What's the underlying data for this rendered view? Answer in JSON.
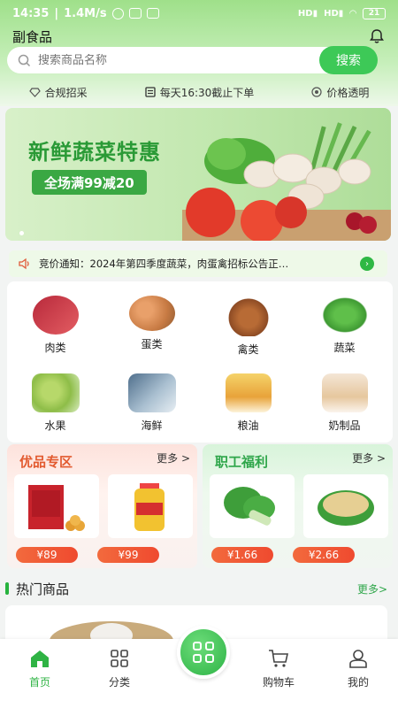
{
  "status": {
    "time": "14:35",
    "speed": "1.4M/s",
    "battery": "21"
  },
  "header": {
    "title": "副食品"
  },
  "search": {
    "placeholder": "搜索商品名称",
    "button": "搜索"
  },
  "features": [
    "合规招采",
    "每天16:30截止下单",
    "价格透明"
  ],
  "banner": {
    "title": "新鲜蔬菜特惠",
    "tag": "全场满99减20"
  },
  "notice": {
    "text": "竞价通知：2024年第四季度蔬菜，肉蛋禽招标公告正…"
  },
  "categories": [
    {
      "label": "肉类",
      "icon": "meat-icon"
    },
    {
      "label": "蛋类",
      "icon": "egg-icon"
    },
    {
      "label": "禽类",
      "icon": "poultry-icon"
    },
    {
      "label": "蔬菜",
      "icon": "vegetable-icon"
    },
    {
      "label": "水果",
      "icon": "fruit-icon"
    },
    {
      "label": "海鲜",
      "icon": "seafood-icon"
    },
    {
      "label": "粮油",
      "icon": "grain-oil-icon"
    },
    {
      "label": "奶制品",
      "icon": "dairy-icon"
    }
  ],
  "promo": {
    "left": {
      "title": "优品专区",
      "more": "更多 >",
      "prices": [
        "¥89",
        "¥99"
      ]
    },
    "right": {
      "title": "职工福利",
      "more": "更多 >",
      "prices": [
        "¥1.66",
        "¥2.66"
      ]
    }
  },
  "hot": {
    "title": "热门商品",
    "more": "更多>"
  },
  "tabs": [
    {
      "label": "首页",
      "icon": "home-icon"
    },
    {
      "label": "分类",
      "icon": "category-icon"
    },
    {
      "label": "购物车",
      "icon": "cart-icon"
    },
    {
      "label": "我的",
      "icon": "profile-icon"
    }
  ],
  "colors": {
    "brand": "#3dc957",
    "price": "#ef4a2f",
    "accent_red": "#e25a2f"
  }
}
